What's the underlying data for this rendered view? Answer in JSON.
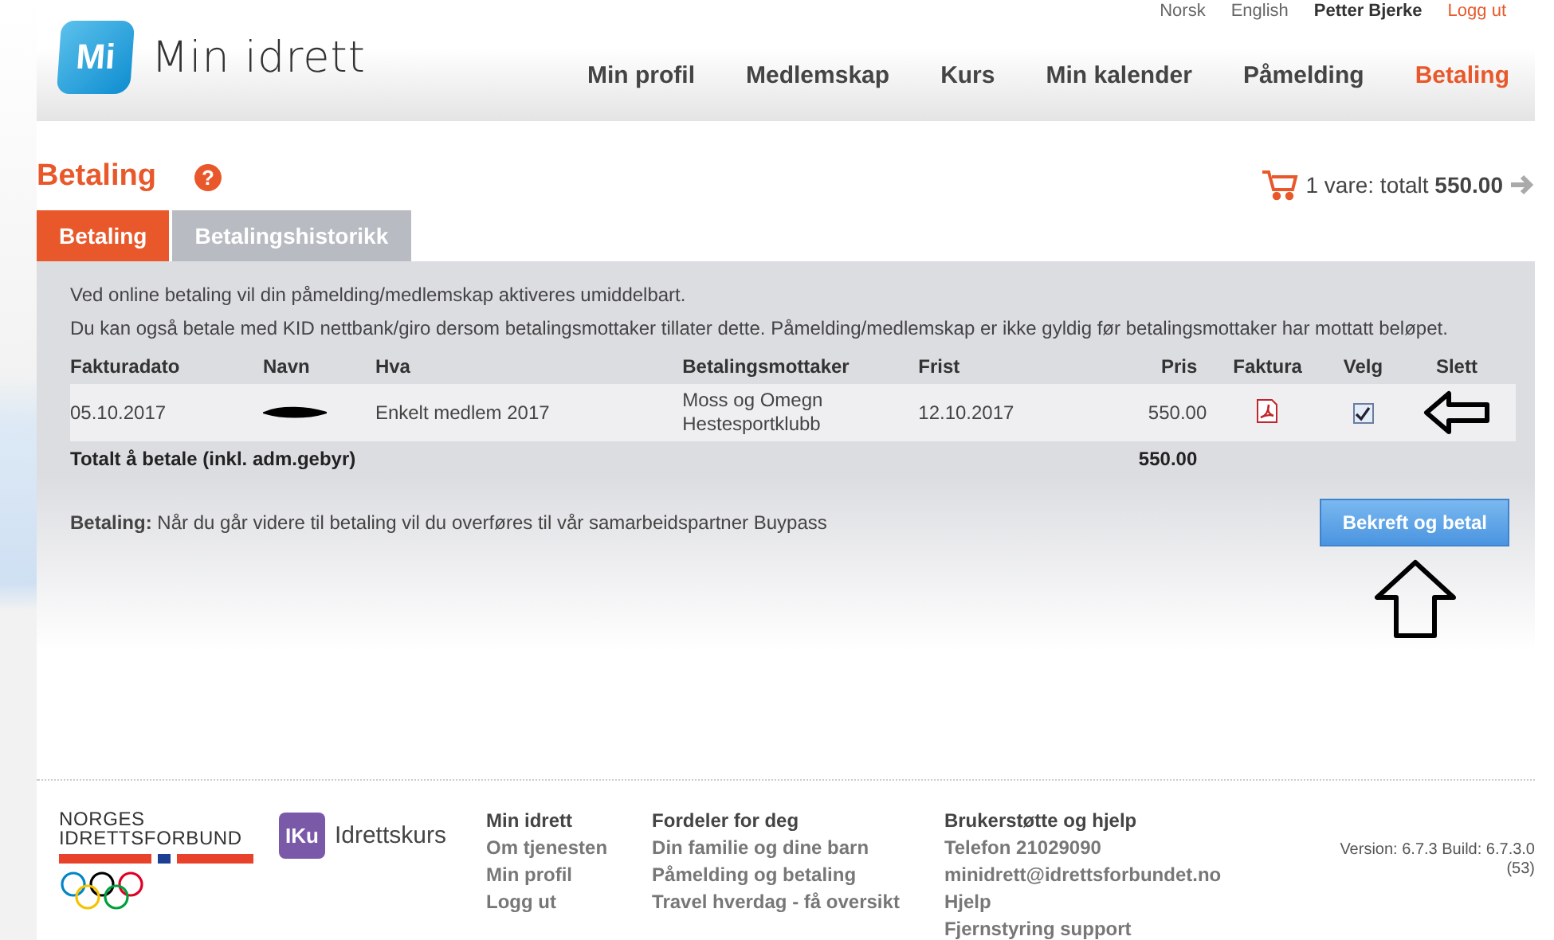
{
  "top_links": [
    {
      "label": "Norsk",
      "kind": "language"
    },
    {
      "label": "English",
      "kind": "language"
    },
    {
      "label": "Petter Bjerke",
      "kind": "user"
    },
    {
      "label": "Logg ut",
      "kind": "logout"
    }
  ],
  "logo": {
    "mark": "Mi",
    "name": "Min idrett"
  },
  "nav": [
    {
      "label": "Min profil",
      "selected": false
    },
    {
      "label": "Medlemskap",
      "selected": false
    },
    {
      "label": "Kurs",
      "selected": false
    },
    {
      "label": "Min kalender",
      "selected": false
    },
    {
      "label": "Påmelding",
      "selected": false
    },
    {
      "label": "Betaling",
      "selected": true
    }
  ],
  "page_title": "Betaling",
  "help_icon": "?",
  "cart": {
    "text": "1 vare: totalt ",
    "total": "550.00"
  },
  "tabs": [
    {
      "label": "Betaling",
      "selected": true
    },
    {
      "label": "Betalingshistorikk",
      "selected": false
    }
  ],
  "info": [
    "Ved online betaling vil din påmelding/medlemskap aktiveres umiddelbart.",
    "Du kan også betale med KID nettbank/giro dersom betalingsmottaker tillater dette. Påmelding/medlemskap er ikke gyldig før betalingsmottaker har mottatt beløpet."
  ],
  "table": {
    "columns": [
      "Fakturadato",
      "Navn",
      "Hva",
      "Betalingsmottaker",
      "Frist",
      "Pris",
      "Faktura",
      "Velg",
      "Slett"
    ],
    "rows": [
      {
        "date": "05.10.2017",
        "name_redacted": true,
        "what": "Enkelt medlem 2017",
        "recipient": "Moss og Omegn Hestesportklubb",
        "due": "12.10.2017",
        "price": "550.00",
        "checked": true
      }
    ],
    "total_label": "Totalt å betale (inkl. adm.gebyr)",
    "total": "550.00"
  },
  "payment_note": "**Betaling:** Når du går videre til betaling vil du overføres til vår samarbeidspartner Buypass",
  "confirm_button": "Bekreft og betal",
  "footer": {
    "org": "NORGES IDRETTSFORBUND",
    "iku": {
      "mark": "IKu",
      "name": "Idrettskurs"
    },
    "columns": [
      {
        "title": "Min idrett",
        "links": [
          "Om tjenesten",
          "Min profil",
          "Logg ut"
        ]
      },
      {
        "title": "Fordeler for deg",
        "links": [
          "Din familie og dine barn",
          "Påmelding og betaling",
          "Travel hverdag - få oversikt"
        ]
      },
      {
        "title": "Brukerstøtte og hjelp",
        "links": [
          "Telefon 21029090",
          "minidrett@idrettsforbundet.no",
          "Hjelp",
          "Fjernstyring support"
        ]
      }
    ],
    "version": "Version: 6.7.3 Build: 6.7.3.0",
    "build": "(53)"
  }
}
